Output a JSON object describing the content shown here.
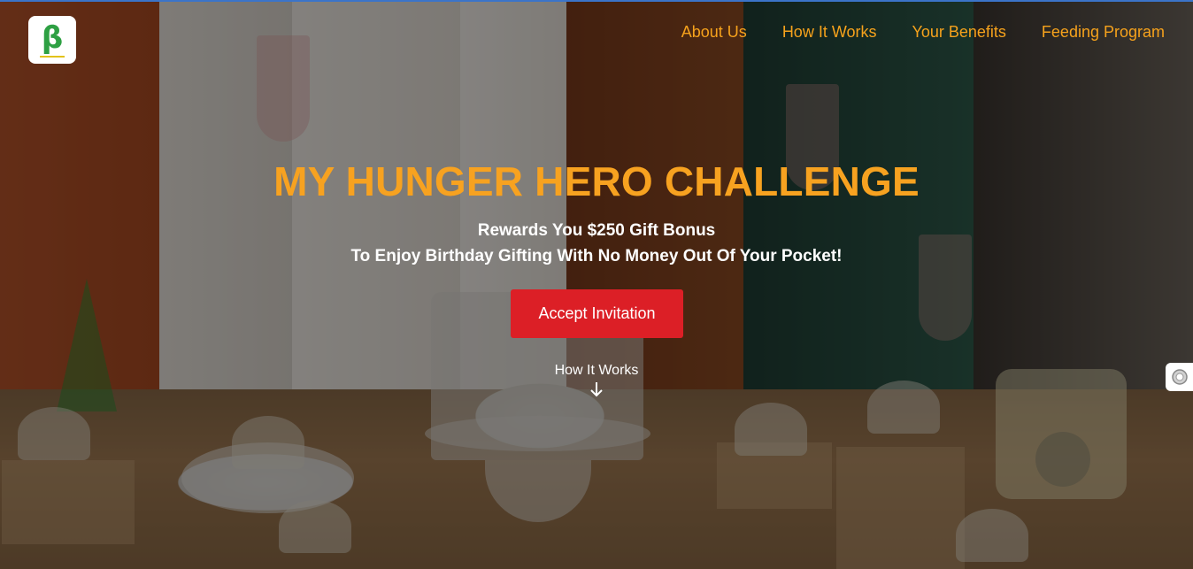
{
  "brand": {
    "logo_letter": "β",
    "logo_colors": {
      "mark": "#2ea043",
      "underline": "#e2c21a"
    }
  },
  "nav": {
    "items": [
      {
        "label": "About Us"
      },
      {
        "label": "How It Works"
      },
      {
        "label": "Your Benefits"
      },
      {
        "label": "Feeding Program"
      }
    ],
    "color": "#f6a21c"
  },
  "hero": {
    "title": "MY HUNGER HERO CHALLENGE",
    "subtitle_line1": "Rewards You $250 Gift Bonus",
    "subtitle_line2": "To Enjoy Birthday Gifting With No Money Out Of Your Pocket!",
    "cta_label": "Accept Invitation",
    "how_link_label": "How It Works",
    "how_link_icon": "arrow-down-icon",
    "title_color": "#f7a220",
    "cta_color": "#dc1f26"
  },
  "side_widget": {
    "icon": "widget-icon"
  }
}
